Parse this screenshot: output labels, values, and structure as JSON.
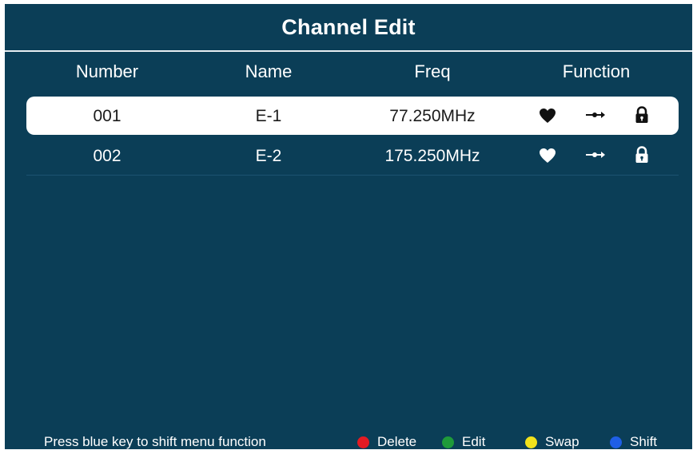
{
  "title": "Channel Edit",
  "columns": {
    "number": "Number",
    "name": "Name",
    "freq": "Freq",
    "function": "Function"
  },
  "channels": [
    {
      "number": "001",
      "name": "E-1",
      "freq": "77.250MHz",
      "selected": true,
      "icons": [
        "favorite-heart-icon",
        "skip-arrow-icon",
        "lock-icon"
      ]
    },
    {
      "number": "002",
      "name": "E-2",
      "freq": "175.250MHz",
      "selected": false,
      "icons": [
        "favorite-heart-icon",
        "skip-arrow-icon",
        "lock-icon"
      ]
    }
  ],
  "footer": {
    "hint": "Press blue key to shift menu function",
    "keys": [
      {
        "label": "Delete",
        "color": "#e31b23"
      },
      {
        "label": "Edit",
        "color": "#1f9a3a"
      },
      {
        "label": "Swap",
        "color": "#f2e21b"
      },
      {
        "label": "Shift",
        "color": "#1f5fe6"
      }
    ]
  },
  "colors": {
    "background": "#0b3e57",
    "selected_row": "#ffffff",
    "text": "#ffffff"
  }
}
